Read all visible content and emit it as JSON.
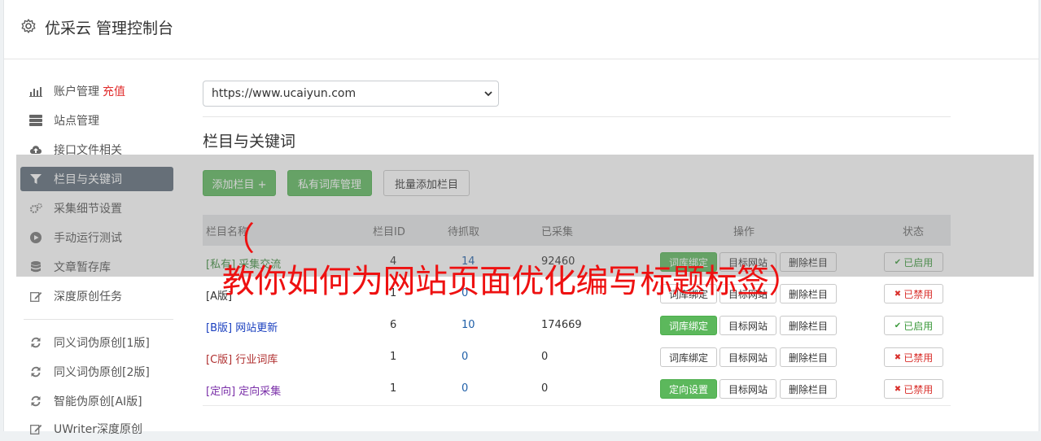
{
  "header": {
    "title": "优采云 管理控制台",
    "icon": "gear-icon"
  },
  "sidebar": {
    "items": [
      {
        "label": "账户管理",
        "extra": "充值",
        "icon": "bar-chart-icon"
      },
      {
        "label": "站点管理",
        "icon": "server-icon"
      },
      {
        "label": "接口文件相关",
        "icon": "cloud-upload-icon"
      },
      {
        "label": "栏目与关键词",
        "icon": "filter-icon",
        "active": true
      },
      {
        "label": "采集细节设置",
        "icon": "cogs-icon"
      },
      {
        "label": "手动运行测试",
        "icon": "play-circle-icon"
      },
      {
        "label": "文章暂存库",
        "icon": "database-icon"
      },
      {
        "label": "深度原创任务",
        "icon": "edit-icon"
      },
      {
        "label": "同义词伪原创[1版]",
        "icon": "refresh-icon"
      },
      {
        "label": "同义词伪原创[2版]",
        "icon": "refresh-icon"
      },
      {
        "label": "智能伪原创[AI版]",
        "icon": "refresh-icon"
      },
      {
        "label": "UWriter深度原创",
        "icon": "edit-icon"
      }
    ]
  },
  "main": {
    "site_select": "https://www.ucaiyun.com",
    "section_title": "栏目与关键词",
    "buttons": {
      "add": "添加栏目 +",
      "private_lib": "私有词库管理",
      "batch_add": "批量添加栏目"
    },
    "table": {
      "headers": [
        "栏目名称",
        "栏目ID",
        "待抓取",
        "已采集",
        "操作",
        "状态"
      ],
      "rows": [
        {
          "tag": "[私有]",
          "name": "采集交流",
          "id": "4",
          "pending": "14",
          "collected": "92460",
          "op1": "词库绑定",
          "op2": "目标网站",
          "op3": "删除栏目",
          "status": "已启用",
          "tag_color": "#3c8c3c",
          "op1_style": "green"
        },
        {
          "tag": "[A版]",
          "name": "",
          "id": "1",
          "pending": "0",
          "collected": "",
          "op1": "词库绑定",
          "op2": "目标网站",
          "op3": "删除栏目",
          "status": "已禁用",
          "tag_color": "#333333",
          "op1_style": "plain"
        },
        {
          "tag": "[B版]",
          "name": "网站更新",
          "id": "6",
          "pending": "10",
          "collected": "174669",
          "op1": "词库绑定",
          "op2": "目标网站",
          "op3": "删除栏目",
          "status": "已启用",
          "tag_color": "#1a3fbf",
          "op1_style": "green"
        },
        {
          "tag": "[C版]",
          "name": "行业词库",
          "id": "1",
          "pending": "0",
          "collected": "0",
          "op1": "词库绑定",
          "op2": "目标网站",
          "op3": "删除栏目",
          "status": "已禁用",
          "tag_color": "#b03030",
          "op1_style": "plain"
        },
        {
          "tag": "[定向]",
          "name": "定向采集",
          "id": "1",
          "pending": "0",
          "collected": "0",
          "op1": "定向设置",
          "op2": "目标网站",
          "op3": "删除栏目",
          "status": "已禁用",
          "tag_color": "#7a2fa8",
          "op1_style": "green"
        }
      ]
    }
  },
  "overlay": {
    "title": "（\n教你如何为网站页面优化编写标题标签）"
  },
  "colors": {
    "green": "#5cb85c",
    "active_bg": "#5c6b78",
    "recharge": "#e12c2c",
    "overlay_text": "#ee1111"
  }
}
